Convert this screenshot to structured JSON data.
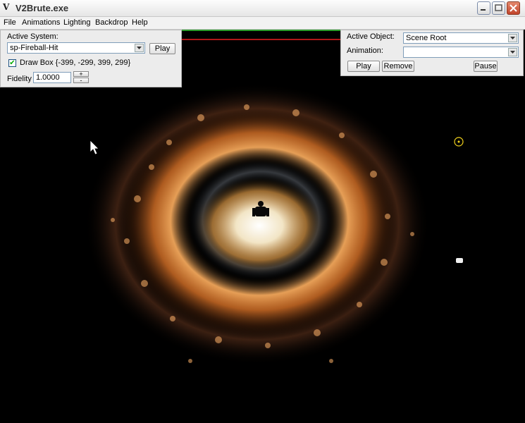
{
  "window": {
    "title": "V2Brute.exe",
    "logo": "V"
  },
  "menu": [
    "File",
    "Animations",
    "Lighting",
    "Backdrop",
    "Help"
  ],
  "left_panel": {
    "active_system_label": "Active System:",
    "active_system_value": "sp-Fireball-Hit",
    "play_label": "Play",
    "draw_box_checked": true,
    "draw_box_label": "Draw Box {-399, -299, 399, 299}",
    "fidelity_label": "Fidelity",
    "fidelity_value": "1.0000",
    "plus": "+",
    "minus": "-"
  },
  "right_panel": {
    "active_object_label": "Active Object:",
    "active_object_value": "Scene Root",
    "animation_label": "Animation:",
    "animation_value": "",
    "play_label": "Play",
    "remove_label": "Remove",
    "pause_label": "Pause"
  },
  "colors": {
    "fireball_core": "#ffffff",
    "fireball_mid": "#ff9a3c",
    "fireball_outer": "#c85a18",
    "smoke": "#9aa3b0",
    "marker": "#f2d21c"
  }
}
